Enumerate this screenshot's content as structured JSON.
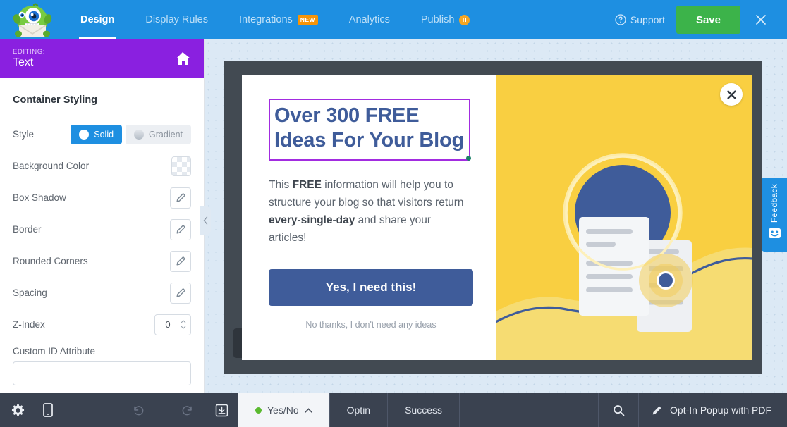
{
  "topnav": {
    "logo_alt": "optinmonster-mascot-logo",
    "items": [
      {
        "label": "Design",
        "active": true,
        "badge": null
      },
      {
        "label": "Display Rules",
        "active": false,
        "badge": null
      },
      {
        "label": "Integrations",
        "active": false,
        "badge": "NEW"
      },
      {
        "label": "Analytics",
        "active": false,
        "badge": null
      },
      {
        "label": "Publish",
        "active": false,
        "badge": "pause"
      }
    ],
    "support_label": "Support",
    "save_label": "Save",
    "close_label": "×",
    "bg_color": "#1e8fe1",
    "save_color": "#3cb34a",
    "badge_new_color": "#f89406"
  },
  "sidebar": {
    "editing_label": "EDITING:",
    "editing_value": "Text",
    "header_color": "#8a20e0",
    "panel_title": "Container Styling",
    "style_row_label": "Style",
    "style_options": [
      {
        "label": "Solid",
        "selected": true
      },
      {
        "label": "Gradient",
        "selected": false
      }
    ],
    "rows": [
      {
        "label": "Background Color",
        "control": "swatch"
      },
      {
        "label": "Box Shadow",
        "control": "pencil"
      },
      {
        "label": "Border",
        "control": "pencil"
      },
      {
        "label": "Rounded Corners",
        "control": "pencil"
      },
      {
        "label": "Spacing",
        "control": "pencil"
      }
    ],
    "zindex_label": "Z-Index",
    "zindex_value": "0",
    "custom_id_label": "Custom ID Attribute",
    "custom_id_value": "",
    "custom_id_placeholder": ""
  },
  "popup": {
    "headline_line1": "Over 300 FREE",
    "headline_line2": "Ideas For Your Blog",
    "headline_color": "#3f5c9a",
    "selection_border_color": "#a22ce0",
    "body_pre": "This ",
    "body_bold1": "FREE",
    "body_mid": " information will help you to structure your blog so that visitors return ",
    "body_bold2": "every-single-day",
    "body_post": " and share your articles!",
    "cta_label": "Yes, I need this!",
    "cta_color": "#3f5c9a",
    "decline_label": "No thanks, I don't need any ideas",
    "close_label": "✕",
    "illustration_bg": "#f9cf41",
    "illustration_accent": "#3f5c9a"
  },
  "feedback": {
    "label": "Feedback",
    "color": "#1e8fe1"
  },
  "bottombar": {
    "bg_color": "#3a4250",
    "icons": {
      "settings": "gear-icon",
      "mobile": "mobile-icon",
      "undo": "undo-icon",
      "redo": "redo-icon",
      "export": "export-icon",
      "search": "search-icon",
      "edit": "pencil-icon"
    },
    "tabs": [
      {
        "label": "Yes/No",
        "active": true,
        "has_status_dot": true,
        "has_chevron": true
      },
      {
        "label": "Optin",
        "active": false,
        "has_status_dot": false,
        "has_chevron": false
      },
      {
        "label": "Success",
        "active": false,
        "has_status_dot": false,
        "has_chevron": false
      }
    ],
    "status_dot_color": "#5aba2f",
    "campaign_name": "Opt-In Popup with PDF"
  }
}
